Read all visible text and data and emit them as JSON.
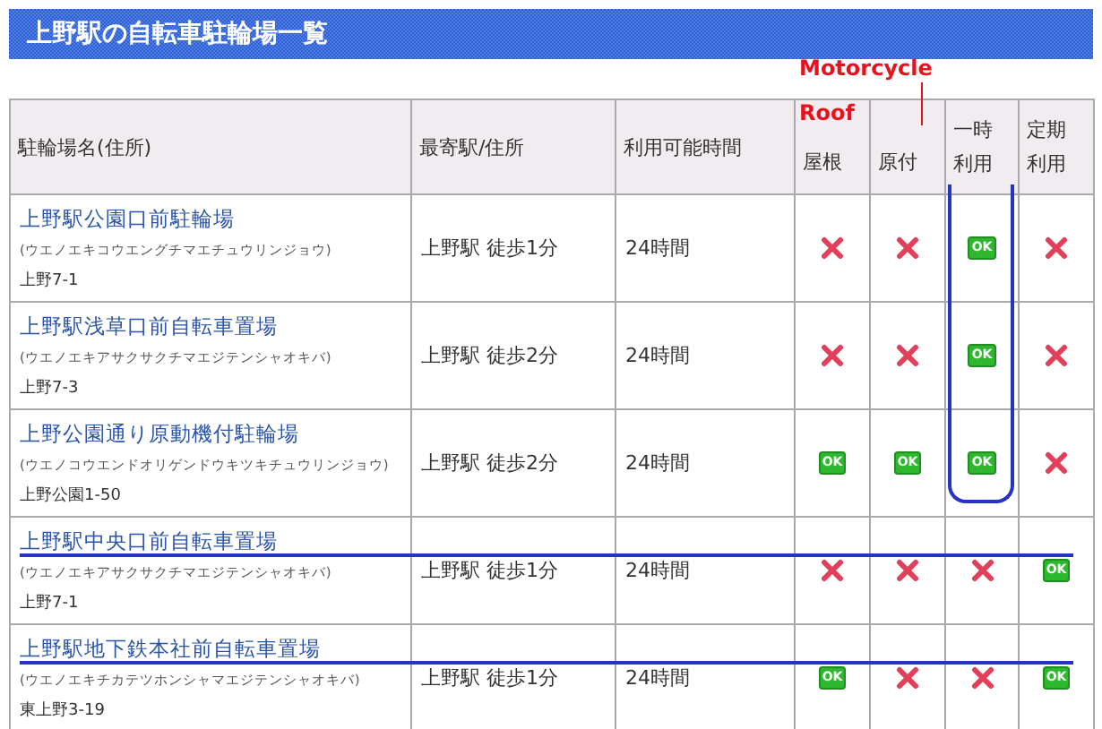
{
  "title": "上野駅の自転車駐輪場一覧",
  "columns": [
    "駐輪場名(住所)",
    "最寄駅/住所",
    "利用可能時間",
    "屋根",
    "原付",
    "一時利用",
    "定期利用"
  ],
  "rows": [
    {
      "name": "上野駅公園口前駐輪場",
      "reading": "(ウエノエキコウエングチマエチュウリンジョウ)",
      "address": "上野7-1",
      "station": "上野駅 徒歩1分",
      "hours": "24時間",
      "roof": false,
      "moped": false,
      "temporary": "OK",
      "regular": false,
      "struck": false
    },
    {
      "name": "上野駅浅草口前自転車置場",
      "reading": "(ウエノエキアサクサクチマエジテンシャオキバ)",
      "address": "上野7-3",
      "station": "上野駅 徒歩2分",
      "hours": "24時間",
      "roof": false,
      "moped": false,
      "temporary": "OK",
      "regular": false,
      "struck": false
    },
    {
      "name": "上野公園通り原動機付駐輪場",
      "reading": "(ウエノコウエンドオリゲンドウキツキチュウリンジョウ)",
      "address": "上野公園1-50",
      "station": "上野駅 徒歩2分",
      "hours": "24時間",
      "roof": "OK",
      "moped": "OK",
      "temporary": "OK",
      "regular": false,
      "struck": false
    },
    {
      "name": "上野駅中央口前自転車置場",
      "reading": "(ウエノエキアサクサクチマエジテンシャオキバ)",
      "address": "上野7-1",
      "station": "上野駅 徒歩1分",
      "hours": "24時間",
      "roof": false,
      "moped": false,
      "temporary": false,
      "regular": "OK",
      "struck": true
    },
    {
      "name": "上野駅地下鉄本社前自転車置場",
      "reading": "(ウエノエキチカテツホンシャマエジテンシャオキバ)",
      "address": "東上野3-19",
      "station": "上野駅 徒歩1分",
      "hours": "24時間",
      "roof": "OK",
      "moped": false,
      "temporary": false,
      "regular": "OK",
      "struck": true
    }
  ],
  "annotations": {
    "motorcycle": "Motorcycle",
    "roof": "Roof"
  }
}
